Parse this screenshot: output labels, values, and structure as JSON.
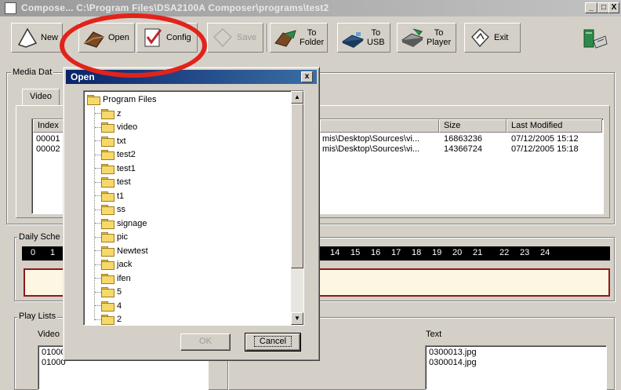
{
  "window": {
    "title": "Compose... C:\\Program Files\\DSA2100A Composer\\programs\\test2",
    "minimize": "_",
    "maximize": "□",
    "close": "X"
  },
  "toolbar": {
    "new_label": "New",
    "open_label": "Open",
    "config_label": "Config",
    "save_label": "Save",
    "to_folder_label_1": "To",
    "to_folder_label_2": "Folder",
    "to_usb_label_1": "To",
    "to_usb_label_2": "USB",
    "to_player_label_1": "To",
    "to_player_label_2": "Player",
    "exit_label": "Exit"
  },
  "media_db": {
    "group_title": "Media Dat",
    "tab_video": "Video",
    "columns": {
      "index": "Index",
      "size": "Size",
      "last_modified": "Last Modified"
    },
    "rows": [
      {
        "index": "00001",
        "path": "mis\\Desktop\\Sources\\vi...",
        "size": "16863236",
        "modified": "07/12/2005 15:12"
      },
      {
        "index": "00002",
        "path": "mis\\Desktop\\Sources\\vi...",
        "size": "14366724",
        "modified": "07/12/2005 15:18"
      }
    ]
  },
  "schedule": {
    "group_title": "Daily Sche",
    "hours_left": [
      "0",
      "1"
    ],
    "hours_right": [
      "14",
      "15",
      "16",
      "17",
      "18",
      "19",
      "20",
      "21",
      "22",
      "23",
      "24"
    ]
  },
  "playlists": {
    "group_title": "Play Lists",
    "video_label": "Video",
    "video_items": [
      "01000",
      "01000"
    ],
    "text_label": "Text",
    "text_items": [
      "0300013.jpg",
      "0300014.jpg"
    ]
  },
  "open_dialog": {
    "title": "Open",
    "close": "x",
    "root_folder": "Program Files",
    "folders": [
      "z",
      "video",
      "txt",
      "test2",
      "test1",
      "test",
      "t1",
      "ss",
      "signage",
      "pic",
      "Newtest",
      "jack",
      "ifen",
      "5",
      "4",
      "2"
    ],
    "ok_label": "OK",
    "cancel_label": "Cancel"
  },
  "colors": {
    "annotation_circle": "#e2231a",
    "dialog_title_bar": "#0a246a",
    "folder_yellow": "#f5d96b",
    "schedule_bar_fill": "#fdf6e3"
  }
}
